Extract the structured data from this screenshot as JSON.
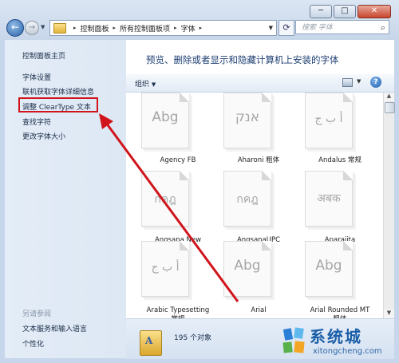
{
  "window": {
    "caption_buttons": [
      "─",
      "□",
      "✕"
    ],
    "address_path": [
      "控制面板",
      "所有控制面板项",
      "字体"
    ],
    "search_placeholder": "搜索 字体"
  },
  "sidebar": {
    "home": "控制面板主页",
    "links": [
      "字体设置",
      "联机获取字体详细信息",
      "调整 ClearType 文本",
      "查找字符",
      "更改字体大小"
    ],
    "highlighted_index": 2,
    "see_also_heading": "另请参阅",
    "see_also_links": [
      "文本服务和输入语言",
      "个性化"
    ]
  },
  "main": {
    "heading": "预览、删除或者显示和隐藏计算机上安装的字体",
    "organize_label": "组织",
    "help_label": "?"
  },
  "fonts": [
    {
      "name": "Agency FB",
      "preview": "Abg"
    },
    {
      "name": "Aharoni 粗体",
      "preview": "אנק"
    },
    {
      "name": "Andalus 常规",
      "preview": "أ ب ج"
    },
    {
      "name": "Angsana New",
      "preview": "กคฎ"
    },
    {
      "name": "AngsanaUPC",
      "preview": "กคฎ"
    },
    {
      "name": "Aparajita",
      "preview": "अबक"
    },
    {
      "name": "Arabic Typesetting 常规",
      "preview": "أ ب ج"
    },
    {
      "name": "Arial",
      "preview": "Abg"
    },
    {
      "name": "Arial Rounded MT 粗体",
      "preview": "Abg"
    }
  ],
  "status": {
    "count_text": "195 个对象"
  },
  "watermark": {
    "cn": "系统城",
    "en": "xitongcheng.com"
  },
  "colors": {
    "highlight_red": "#d0141b",
    "link_blue": "#1b2c48",
    "heading_blue": "#1e3f73"
  }
}
